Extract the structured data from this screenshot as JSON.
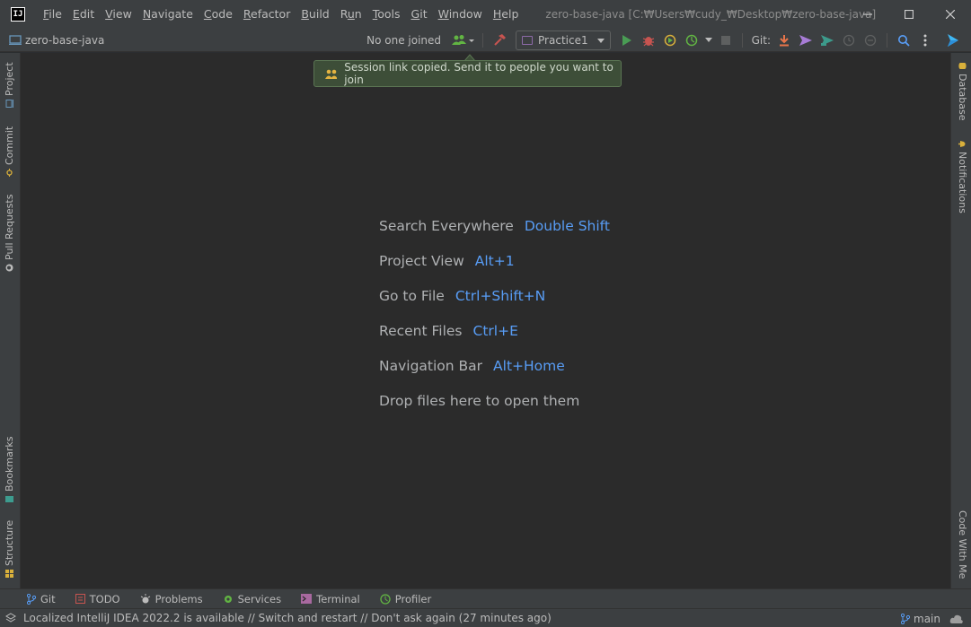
{
  "titlebar": {
    "logo_text": "IJ",
    "menu": [
      {
        "pre": "",
        "mn": "F",
        "post": "ile"
      },
      {
        "pre": "",
        "mn": "E",
        "post": "dit"
      },
      {
        "pre": "",
        "mn": "V",
        "post": "iew"
      },
      {
        "pre": "",
        "mn": "N",
        "post": "avigate"
      },
      {
        "pre": "",
        "mn": "C",
        "post": "ode"
      },
      {
        "pre": "",
        "mn": "R",
        "post": "efactor"
      },
      {
        "pre": "",
        "mn": "B",
        "post": "uild"
      },
      {
        "pre": "R",
        "mn": "u",
        "post": "n"
      },
      {
        "pre": "",
        "mn": "T",
        "post": "ools"
      },
      {
        "pre": "",
        "mn": "G",
        "post": "it"
      },
      {
        "pre": "",
        "mn": "W",
        "post": "indow"
      },
      {
        "pre": "",
        "mn": "H",
        "post": "elp"
      }
    ],
    "window_title": "zero-base-java [C:₩Users₩cudy_₩Desktop₩zero-base-java]"
  },
  "toolbar": {
    "project_name": "zero-base-java",
    "collab_status": "No one joined",
    "run_config": "Practice1",
    "git_label": "Git:"
  },
  "balloon": {
    "text": "Session link copied. Send it to people you want to join"
  },
  "left_tabs": {
    "project": "Project",
    "commit": "Commit",
    "pull_requests": "Pull Requests",
    "bookmarks": "Bookmarks",
    "structure": "Structure"
  },
  "right_tabs": {
    "database": "Database",
    "notifications": "Notifications",
    "code_with_me": "Code With Me"
  },
  "hints": {
    "search": {
      "label": "Search Everywhere",
      "key": "Double Shift"
    },
    "project_view": {
      "label": "Project View",
      "key": "Alt+1"
    },
    "goto_file": {
      "label": "Go to File",
      "key": "Ctrl+Shift+N"
    },
    "recent_files": {
      "label": "Recent Files",
      "key": "Ctrl+E"
    },
    "nav_bar": {
      "label": "Navigation Bar",
      "key": "Alt+Home"
    },
    "drop_files": "Drop files here to open them"
  },
  "bottom_tabs": {
    "git": "Git",
    "todo": "TODO",
    "problems": "Problems",
    "services": "Services",
    "terminal": "Terminal",
    "profiler": "Profiler"
  },
  "statusbar": {
    "message": "Localized IntelliJ IDEA 2022.2 is available // Switch and restart // Don't ask again (27 minutes ago)",
    "branch": "main"
  },
  "colors": {
    "accent_blue": "#589df6",
    "run_green": "#499c54",
    "debug_red": "#c75450",
    "balloon_bg": "#3d4e38"
  }
}
